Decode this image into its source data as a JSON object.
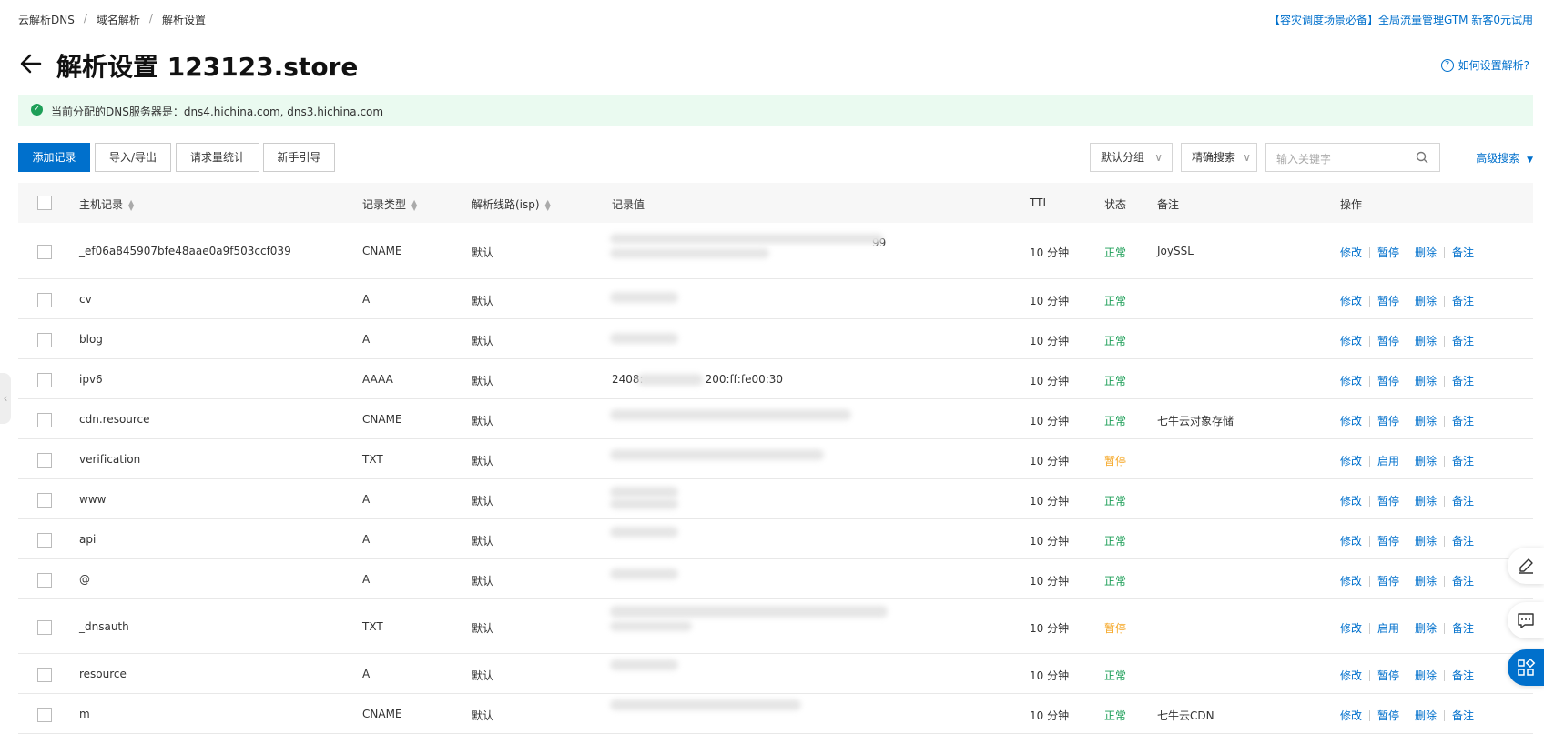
{
  "breadcrumb": [
    "云解析DNS",
    "域名解析",
    "解析设置"
  ],
  "promo": "【容灾调度场景必备】全局流量管理GTM 新客0元试用",
  "title": "解析设置 123123.store",
  "help_link": "如何设置解析?",
  "notice": "当前分配的DNS服务器是：dns4.hichina.com, dns3.hichina.com",
  "toolbar": {
    "add": "添加记录",
    "import_export": "导入/导出",
    "stats": "请求量统计",
    "guide": "新手引导",
    "group": "默认分组",
    "match": "精确搜索",
    "search_placeholder": "输入关键字",
    "advanced": "高级搜索"
  },
  "columns": {
    "host": "主机记录",
    "type": "记录类型",
    "line": "解析线路(isp)",
    "value": "记录值",
    "ttl": "TTL",
    "status": "状态",
    "remark": "备注",
    "ops": "操作"
  },
  "records": [
    {
      "host": "_ef06a845907bfe48aae0a9f503ccf039",
      "type": "CNAME",
      "line": "默认",
      "value": "99",
      "ttl": "10 分钟",
      "status": "正常",
      "remark": "JoySSL",
      "toggle": "暂停"
    },
    {
      "host": "cv",
      "type": "A",
      "line": "默认",
      "value": "",
      "ttl": "10 分钟",
      "status": "正常",
      "remark": "",
      "toggle": "暂停"
    },
    {
      "host": "blog",
      "type": "A",
      "line": "默认",
      "value": "",
      "ttl": "10 分钟",
      "status": "正常",
      "remark": "",
      "toggle": "暂停"
    },
    {
      "host": "ipv6",
      "type": "AAAA",
      "line": "默认",
      "value_prefix": "2408:",
      "value": "200:ff:fe00:30",
      "ttl": "10 分钟",
      "status": "正常",
      "remark": "",
      "toggle": "暂停"
    },
    {
      "host": "cdn.resource",
      "type": "CNAME",
      "line": "默认",
      "value": "",
      "ttl": "10 分钟",
      "status": "正常",
      "remark": "七牛云对象存储",
      "toggle": "暂停"
    },
    {
      "host": "verification",
      "type": "TXT",
      "line": "默认",
      "value": "",
      "ttl": "10 分钟",
      "status": "暂停",
      "remark": "",
      "toggle": "启用"
    },
    {
      "host": "www",
      "type": "A",
      "line": "默认",
      "value": "",
      "ttl": "10 分钟",
      "status": "正常",
      "remark": "",
      "toggle": "暂停"
    },
    {
      "host": "api",
      "type": "A",
      "line": "默认",
      "value": "",
      "ttl": "10 分钟",
      "status": "正常",
      "remark": "",
      "toggle": "暂停"
    },
    {
      "host": "@",
      "type": "A",
      "line": "默认",
      "value": "",
      "ttl": "10 分钟",
      "status": "正常",
      "remark": "",
      "toggle": "暂停"
    },
    {
      "host": "_dnsauth",
      "type": "TXT",
      "line": "默认",
      "value": "",
      "ttl": "10 分钟",
      "status": "暂停",
      "remark": "",
      "toggle": "启用"
    },
    {
      "host": "resource",
      "type": "A",
      "line": "默认",
      "value": "",
      "ttl": "10 分钟",
      "status": "正常",
      "remark": "",
      "toggle": "暂停"
    },
    {
      "host": "m",
      "type": "CNAME",
      "line": "默认",
      "value": "",
      "ttl": "10 分钟",
      "status": "正常",
      "remark": "七牛云CDN",
      "toggle": "暂停"
    }
  ],
  "row_actions": {
    "edit": "修改",
    "delete": "删除",
    "remark": "备注"
  },
  "colors": {
    "accent": "#0070cc",
    "ok": "#1e9f58",
    "paused": "#f5a623",
    "notice_bg": "#eafaf0"
  }
}
